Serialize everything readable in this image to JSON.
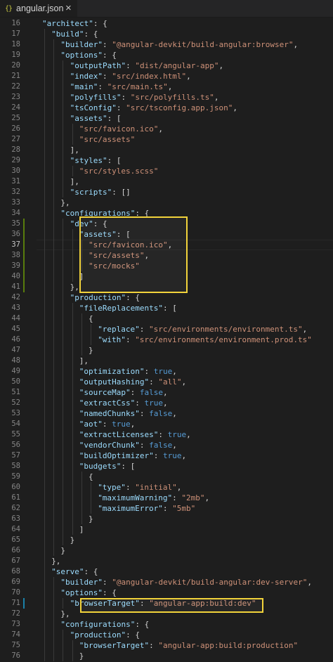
{
  "tab": {
    "icon": "{}",
    "title": "angular.json",
    "close": "×"
  },
  "colors": {
    "key": "#9cdcfe",
    "string": "#ce9178",
    "boolean": "#569cd6",
    "punct": "#d4d4d4",
    "highlight": "#f2d33b",
    "added": "#587c0c"
  },
  "lines": [
    {
      "n": "16",
      "i": 1,
      "t": [
        [
          "k",
          "\"architect\""
        ],
        [
          "p",
          ": {"
        ]
      ]
    },
    {
      "n": "17",
      "i": 2,
      "t": [
        [
          "k",
          "\"build\""
        ],
        [
          "p",
          ": {"
        ]
      ]
    },
    {
      "n": "18",
      "i": 3,
      "t": [
        [
          "k",
          "\"builder\""
        ],
        [
          "p",
          ": "
        ],
        [
          "s",
          "\"@angular-devkit/build-angular:browser\""
        ],
        [
          "p",
          ","
        ]
      ]
    },
    {
      "n": "19",
      "i": 3,
      "t": [
        [
          "k",
          "\"options\""
        ],
        [
          "p",
          ": {"
        ]
      ]
    },
    {
      "n": "20",
      "i": 4,
      "t": [
        [
          "k",
          "\"outputPath\""
        ],
        [
          "p",
          ": "
        ],
        [
          "s",
          "\"dist/angular-app\""
        ],
        [
          "p",
          ","
        ]
      ]
    },
    {
      "n": "21",
      "i": 4,
      "t": [
        [
          "k",
          "\"index\""
        ],
        [
          "p",
          ": "
        ],
        [
          "s",
          "\"src/index.html\""
        ],
        [
          "p",
          ","
        ]
      ]
    },
    {
      "n": "22",
      "i": 4,
      "t": [
        [
          "k",
          "\"main\""
        ],
        [
          "p",
          ": "
        ],
        [
          "s",
          "\"src/main.ts\""
        ],
        [
          "p",
          ","
        ]
      ]
    },
    {
      "n": "23",
      "i": 4,
      "t": [
        [
          "k",
          "\"polyfills\""
        ],
        [
          "p",
          ": "
        ],
        [
          "s",
          "\"src/polyfills.ts\""
        ],
        [
          "p",
          ","
        ]
      ]
    },
    {
      "n": "24",
      "i": 4,
      "t": [
        [
          "k",
          "\"tsConfig\""
        ],
        [
          "p",
          ": "
        ],
        [
          "s",
          "\"src/tsconfig.app.json\""
        ],
        [
          "p",
          ","
        ]
      ]
    },
    {
      "n": "25",
      "i": 4,
      "t": [
        [
          "k",
          "\"assets\""
        ],
        [
          "p",
          ": ["
        ]
      ]
    },
    {
      "n": "26",
      "i": 5,
      "t": [
        [
          "s",
          "\"src/favicon.ico\""
        ],
        [
          "p",
          ","
        ]
      ]
    },
    {
      "n": "27",
      "i": 5,
      "t": [
        [
          "s",
          "\"src/assets\""
        ]
      ]
    },
    {
      "n": "28",
      "i": 4,
      "t": [
        [
          "p",
          "],"
        ]
      ]
    },
    {
      "n": "29",
      "i": 4,
      "t": [
        [
          "k",
          "\"styles\""
        ],
        [
          "p",
          ": ["
        ]
      ]
    },
    {
      "n": "30",
      "i": 5,
      "t": [
        [
          "s",
          "\"src/styles.scss\""
        ]
      ]
    },
    {
      "n": "31",
      "i": 4,
      "t": [
        [
          "p",
          "],"
        ]
      ]
    },
    {
      "n": "32",
      "i": 4,
      "t": [
        [
          "k",
          "\"scripts\""
        ],
        [
          "p",
          ": []"
        ]
      ]
    },
    {
      "n": "33",
      "i": 3,
      "t": [
        [
          "p",
          "},"
        ]
      ]
    },
    {
      "n": "34",
      "i": 3,
      "t": [
        [
          "k",
          "\"configurations\""
        ],
        [
          "p",
          ": {"
        ]
      ]
    },
    {
      "n": "35",
      "i": 4,
      "t": [
        [
          "k",
          "\"dev\""
        ],
        [
          "p",
          ": {"
        ]
      ]
    },
    {
      "n": "36",
      "i": 5,
      "t": [
        [
          "k",
          "\"assets\""
        ],
        [
          "p",
          ": ["
        ]
      ]
    },
    {
      "n": "37",
      "i": 6,
      "t": [
        [
          "s",
          "\"src/favicon.ico\""
        ],
        [
          "p",
          ","
        ]
      ]
    },
    {
      "n": "38",
      "i": 6,
      "t": [
        [
          "s",
          "\"src/assets\""
        ],
        [
          "p",
          ","
        ]
      ]
    },
    {
      "n": "39",
      "i": 6,
      "t": [
        [
          "s",
          "\"src/mocks\""
        ]
      ]
    },
    {
      "n": "40",
      "i": 5,
      "t": [
        [
          "p",
          "]"
        ]
      ]
    },
    {
      "n": "41",
      "i": 4,
      "t": [
        [
          "p",
          "},"
        ]
      ]
    },
    {
      "n": "42",
      "i": 4,
      "t": [
        [
          "k",
          "\"production\""
        ],
        [
          "p",
          ": {"
        ]
      ]
    },
    {
      "n": "43",
      "i": 5,
      "t": [
        [
          "k",
          "\"fileReplacements\""
        ],
        [
          "p",
          ": ["
        ]
      ]
    },
    {
      "n": "44",
      "i": 6,
      "t": [
        [
          "p",
          "{"
        ]
      ]
    },
    {
      "n": "45",
      "i": 7,
      "t": [
        [
          "k",
          "\"replace\""
        ],
        [
          "p",
          ": "
        ],
        [
          "s",
          "\"src/environments/environment.ts\""
        ],
        [
          "p",
          ","
        ]
      ]
    },
    {
      "n": "46",
      "i": 7,
      "t": [
        [
          "k",
          "\"with\""
        ],
        [
          "p",
          ": "
        ],
        [
          "s",
          "\"src/environments/environment.prod.ts\""
        ]
      ]
    },
    {
      "n": "47",
      "i": 6,
      "t": [
        [
          "p",
          "}"
        ]
      ]
    },
    {
      "n": "48",
      "i": 5,
      "t": [
        [
          "p",
          "],"
        ]
      ]
    },
    {
      "n": "49",
      "i": 5,
      "t": [
        [
          "k",
          "\"optimization\""
        ],
        [
          "p",
          ": "
        ],
        [
          "b",
          "true"
        ],
        [
          "p",
          ","
        ]
      ]
    },
    {
      "n": "50",
      "i": 5,
      "t": [
        [
          "k",
          "\"outputHashing\""
        ],
        [
          "p",
          ": "
        ],
        [
          "s",
          "\"all\""
        ],
        [
          "p",
          ","
        ]
      ]
    },
    {
      "n": "51",
      "i": 5,
      "t": [
        [
          "k",
          "\"sourceMap\""
        ],
        [
          "p",
          ": "
        ],
        [
          "b",
          "false"
        ],
        [
          "p",
          ","
        ]
      ]
    },
    {
      "n": "52",
      "i": 5,
      "t": [
        [
          "k",
          "\"extractCss\""
        ],
        [
          "p",
          ": "
        ],
        [
          "b",
          "true"
        ],
        [
          "p",
          ","
        ]
      ]
    },
    {
      "n": "53",
      "i": 5,
      "t": [
        [
          "k",
          "\"namedChunks\""
        ],
        [
          "p",
          ": "
        ],
        [
          "b",
          "false"
        ],
        [
          "p",
          ","
        ]
      ]
    },
    {
      "n": "54",
      "i": 5,
      "t": [
        [
          "k",
          "\"aot\""
        ],
        [
          "p",
          ": "
        ],
        [
          "b",
          "true"
        ],
        [
          "p",
          ","
        ]
      ]
    },
    {
      "n": "55",
      "i": 5,
      "t": [
        [
          "k",
          "\"extractLicenses\""
        ],
        [
          "p",
          ": "
        ],
        [
          "b",
          "true"
        ],
        [
          "p",
          ","
        ]
      ]
    },
    {
      "n": "56",
      "i": 5,
      "t": [
        [
          "k",
          "\"vendorChunk\""
        ],
        [
          "p",
          ": "
        ],
        [
          "b",
          "false"
        ],
        [
          "p",
          ","
        ]
      ]
    },
    {
      "n": "57",
      "i": 5,
      "t": [
        [
          "k",
          "\"buildOptimizer\""
        ],
        [
          "p",
          ": "
        ],
        [
          "b",
          "true"
        ],
        [
          "p",
          ","
        ]
      ]
    },
    {
      "n": "58",
      "i": 5,
      "t": [
        [
          "k",
          "\"budgets\""
        ],
        [
          "p",
          ": ["
        ]
      ]
    },
    {
      "n": "59",
      "i": 6,
      "t": [
        [
          "p",
          "{"
        ]
      ]
    },
    {
      "n": "60",
      "i": 7,
      "t": [
        [
          "k",
          "\"type\""
        ],
        [
          "p",
          ": "
        ],
        [
          "s",
          "\"initial\""
        ],
        [
          "p",
          ","
        ]
      ]
    },
    {
      "n": "61",
      "i": 7,
      "t": [
        [
          "k",
          "\"maximumWarning\""
        ],
        [
          "p",
          ": "
        ],
        [
          "s",
          "\"2mb\""
        ],
        [
          "p",
          ","
        ]
      ]
    },
    {
      "n": "62",
      "i": 7,
      "t": [
        [
          "k",
          "\"maximumError\""
        ],
        [
          "p",
          ": "
        ],
        [
          "s",
          "\"5mb\""
        ]
      ]
    },
    {
      "n": "63",
      "i": 6,
      "t": [
        [
          "p",
          "}"
        ]
      ]
    },
    {
      "n": "64",
      "i": 5,
      "t": [
        [
          "p",
          "]"
        ]
      ]
    },
    {
      "n": "65",
      "i": 4,
      "t": [
        [
          "p",
          "}"
        ]
      ]
    },
    {
      "n": "66",
      "i": 3,
      "t": [
        [
          "p",
          "}"
        ]
      ]
    },
    {
      "n": "67",
      "i": 2,
      "t": [
        [
          "p",
          "},"
        ]
      ]
    },
    {
      "n": "68",
      "i": 2,
      "t": [
        [
          "k",
          "\"serve\""
        ],
        [
          "p",
          ": {"
        ]
      ]
    },
    {
      "n": "69",
      "i": 3,
      "t": [
        [
          "k",
          "\"builder\""
        ],
        [
          "p",
          ": "
        ],
        [
          "s",
          "\"@angular-devkit/build-angular:dev-server\""
        ],
        [
          "p",
          ","
        ]
      ]
    },
    {
      "n": "70",
      "i": 3,
      "t": [
        [
          "k",
          "\"options\""
        ],
        [
          "p",
          ": {"
        ]
      ]
    },
    {
      "n": "71",
      "i": 4,
      "t": [
        [
          "k",
          "\"browserTarget\""
        ],
        [
          "p",
          ": "
        ],
        [
          "s",
          "\"angular-app:build:dev\""
        ]
      ]
    },
    {
      "n": "72",
      "i": 3,
      "t": [
        [
          "p",
          "},"
        ]
      ]
    },
    {
      "n": "73",
      "i": 3,
      "t": [
        [
          "k",
          "\"configurations\""
        ],
        [
          "p",
          ": {"
        ]
      ]
    },
    {
      "n": "74",
      "i": 4,
      "t": [
        [
          "k",
          "\"production\""
        ],
        [
          "p",
          ": {"
        ]
      ]
    },
    {
      "n": "75",
      "i": 5,
      "t": [
        [
          "k",
          "\"browserTarget\""
        ],
        [
          "p",
          ": "
        ],
        [
          "s",
          "\"angular-app:build:production\""
        ]
      ]
    },
    {
      "n": "76",
      "i": 5,
      "t": [
        [
          "p",
          "}"
        ]
      ]
    }
  ],
  "active_line": "37",
  "added_lines": [
    "35",
    "36",
    "37",
    "38",
    "39",
    "40",
    "41"
  ],
  "modified_lines": [
    "71"
  ]
}
